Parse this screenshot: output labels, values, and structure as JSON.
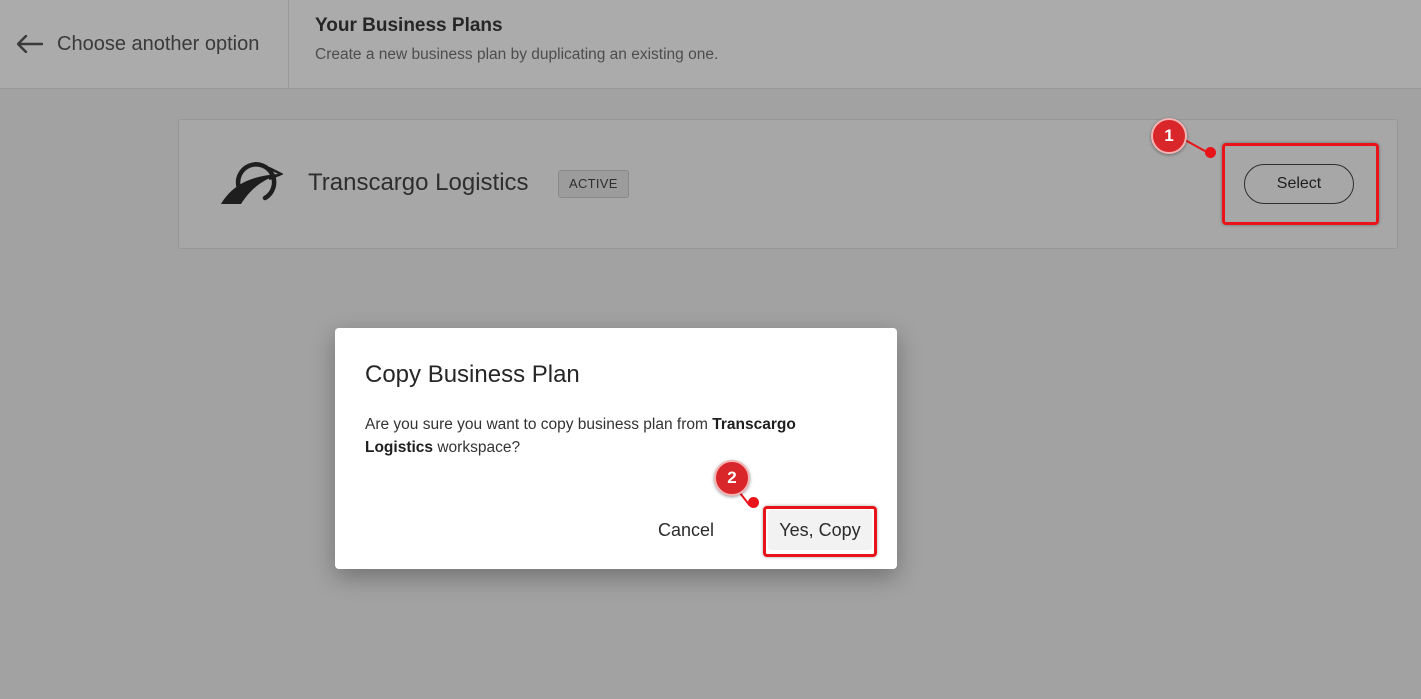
{
  "header": {
    "back_label": "Choose another option",
    "title": "Your Business Plans",
    "subtitle": "Create a new business plan by duplicating an existing one."
  },
  "workspace": {
    "name": "Transcargo Logistics",
    "badge": "ACTIVE",
    "select_label": "Select"
  },
  "dialog": {
    "title": "Copy Business Plan",
    "body_prefix": "Are you sure you want to copy business plan from ",
    "body_workspace": "Transcargo Logistics",
    "body_suffix": " workspace?",
    "cancel_label": "Cancel",
    "confirm_label": "Yes, Copy"
  },
  "annotations": {
    "step1": "1",
    "step2": "2"
  },
  "colors": {
    "annotation_red": "#e8141a",
    "overlay_gray": "#a2a2a2",
    "dialog_bg": "#ffffff"
  }
}
